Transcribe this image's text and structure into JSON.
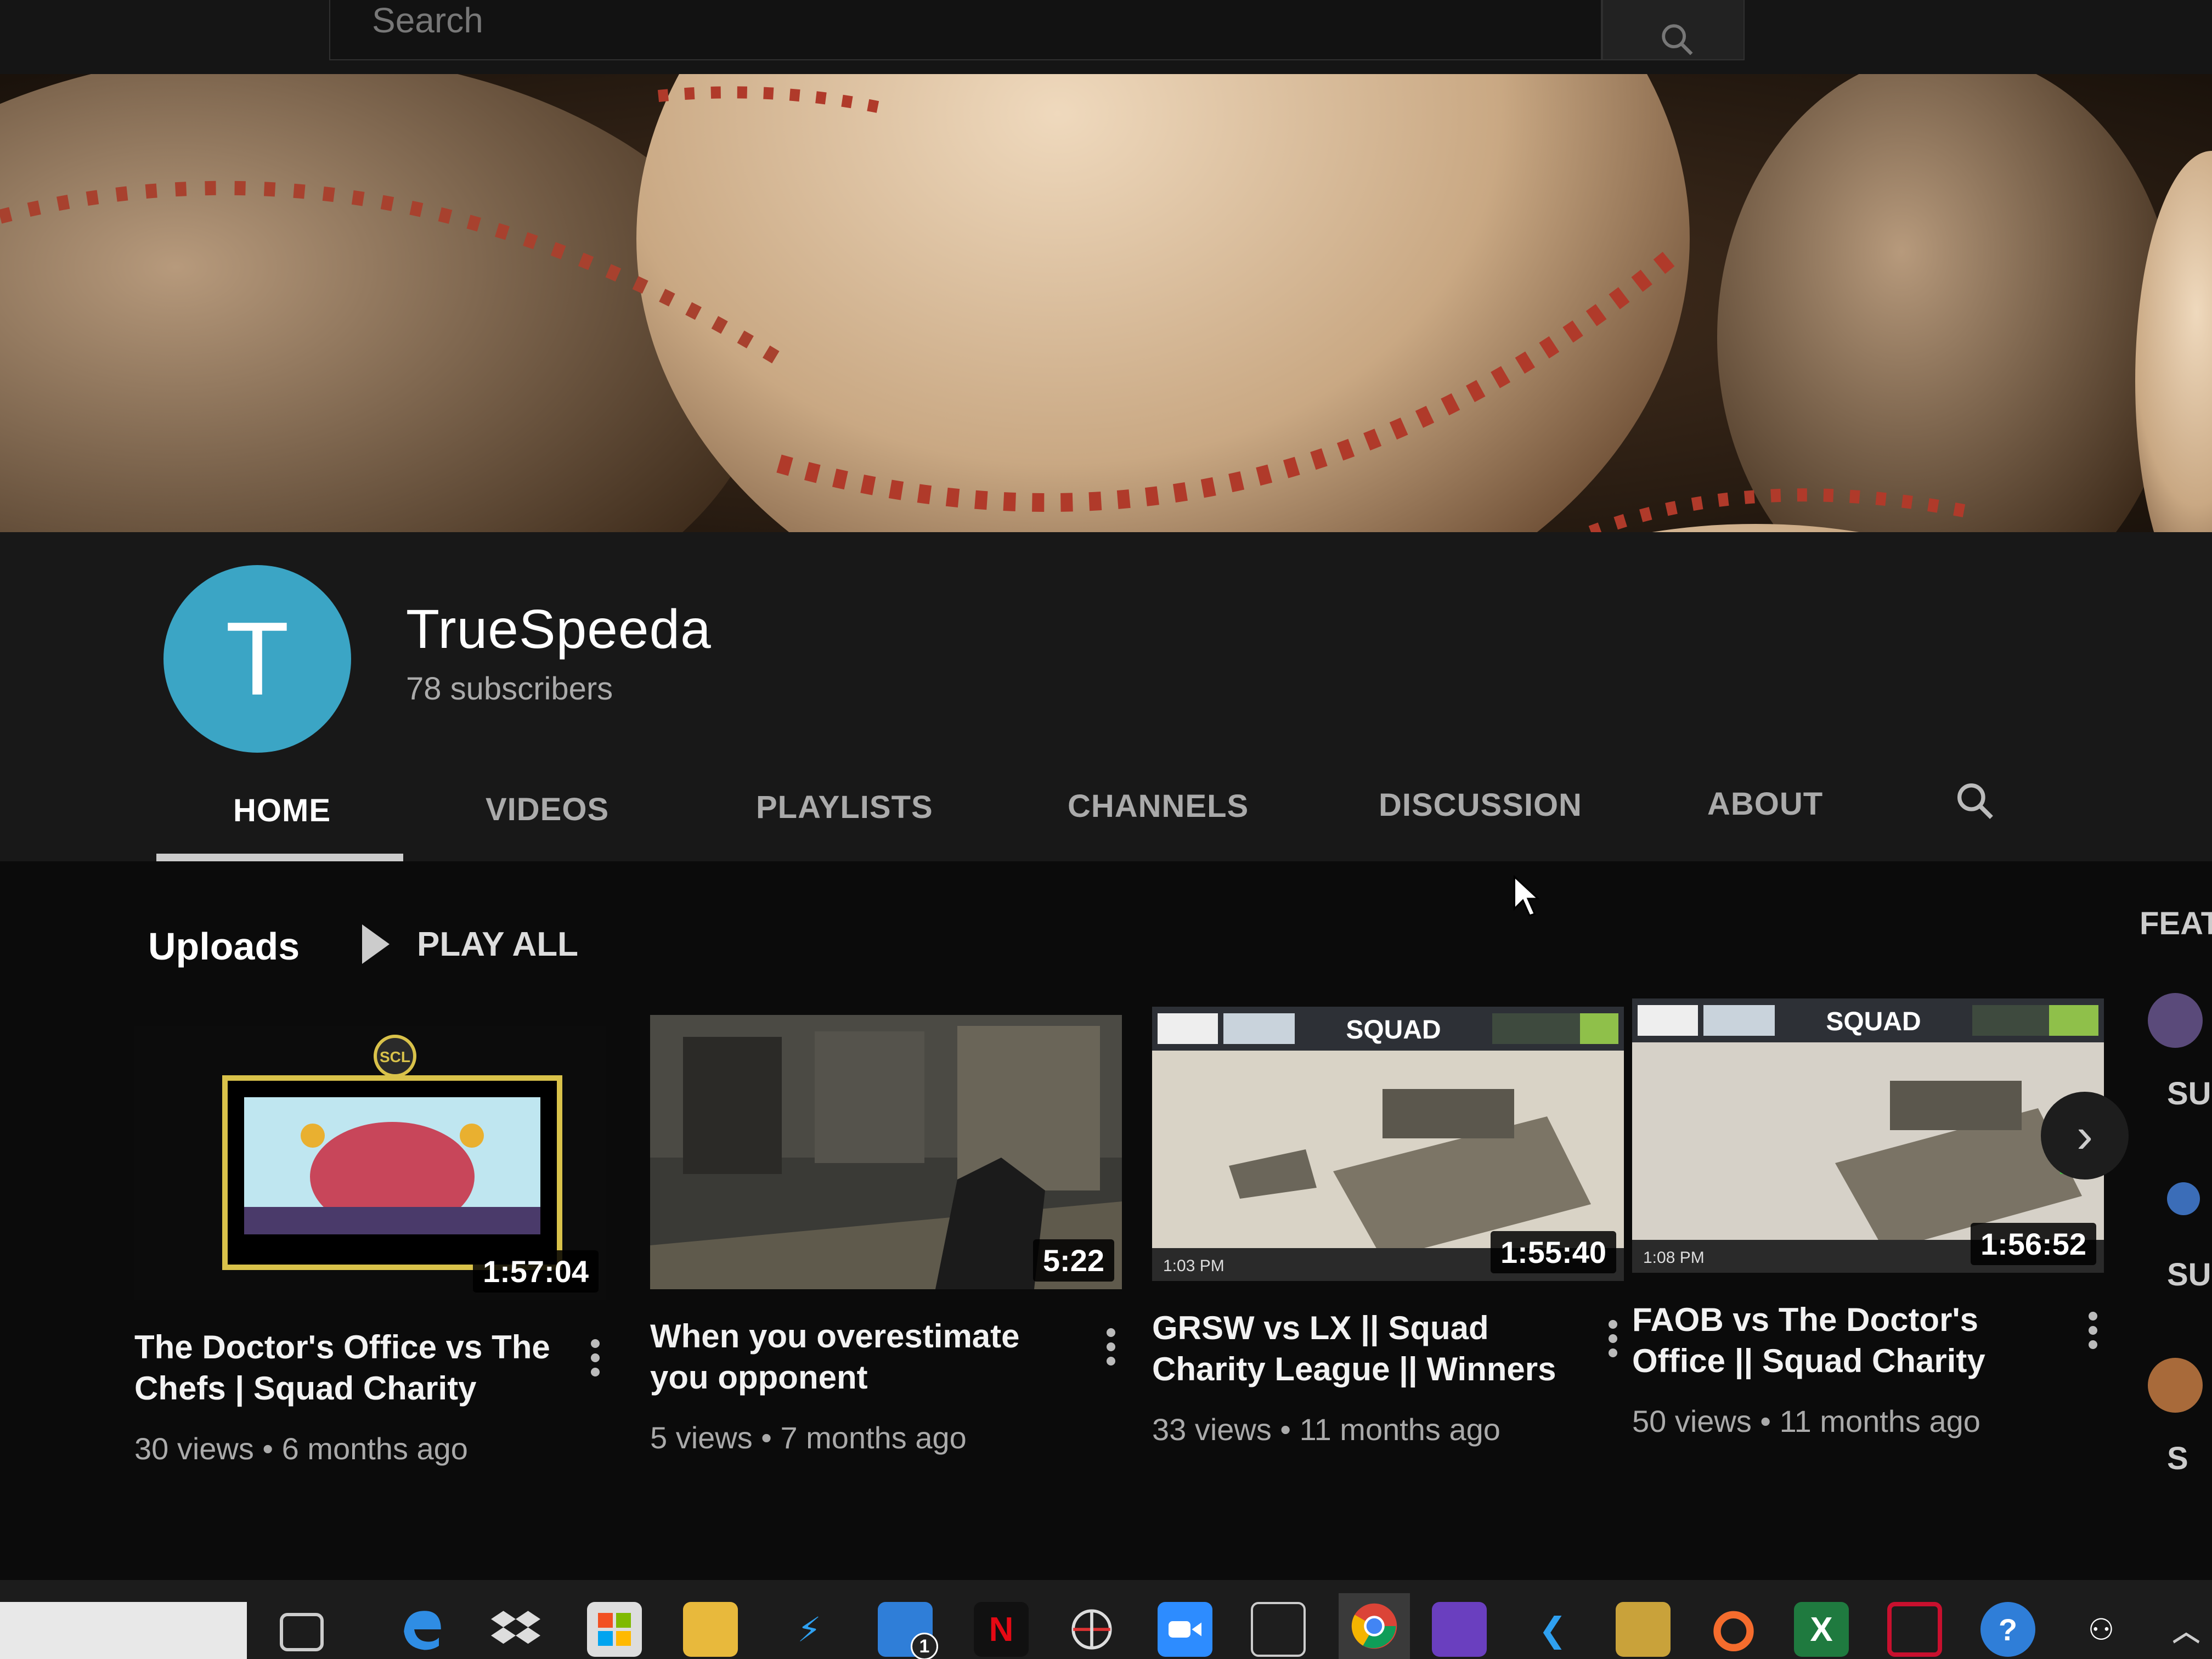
{
  "search": {
    "placeholder": "Search"
  },
  "channel": {
    "avatar_letter": "T",
    "name": "TrueSpeeda",
    "subscribers": "78 subscribers",
    "avatar_color": "#3ba5c5"
  },
  "tabs": [
    {
      "label": "HOME",
      "active": true
    },
    {
      "label": "VIDEOS"
    },
    {
      "label": "PLAYLISTS"
    },
    {
      "label": "CHANNELS"
    },
    {
      "label": "DISCUSSION"
    },
    {
      "label": "ABOUT"
    }
  ],
  "uploads": {
    "title": "Uploads",
    "play_all": "PLAY ALL",
    "videos": [
      {
        "title": "The Doctor's Office vs The Chefs | Squad Charity Leag...",
        "duration": "1:57:04",
        "meta": "30 views • 6 months ago"
      },
      {
        "title": "When you overestimate you opponent",
        "duration": "5:22",
        "meta": "5 views • 7 months ago"
      },
      {
        "title": "GRSW vs LX || Squad Charity League || Winners Bracket...",
        "duration": "1:55:40",
        "meta": "33 views • 11 months ago"
      },
      {
        "title": "FAOB vs The Doctor's Office || Squad Charity League ||...",
        "duration": "1:56:52",
        "meta": "50 views • 11 months ago"
      }
    ]
  },
  "featured": {
    "label": "FEAT",
    "sub_labels": [
      "SU",
      "SU",
      "S"
    ]
  },
  "thumb_text": {
    "scl": "SCL",
    "squad": "SQUAD",
    "time_a": "1:03 PM",
    "time_b": "1:08 PM"
  },
  "taskbar": {
    "icons": [
      "task-view-icon",
      "edge-icon",
      "dropbox-icon",
      "store-icon",
      "file-explorer-icon",
      "vscode-insiders-icon",
      "mail-icon",
      "netflix-icon",
      "network-icon",
      "zoom-icon",
      "snip-icon",
      "chrome-icon",
      "visual-studio-icon",
      "vscode-icon",
      "app-icon",
      "origin-icon",
      "excel-icon",
      "mcafee-icon",
      "help-icon",
      "people-icon"
    ],
    "netflix_letter": "N",
    "excel_letter": "X",
    "mail_badge": "1"
  }
}
